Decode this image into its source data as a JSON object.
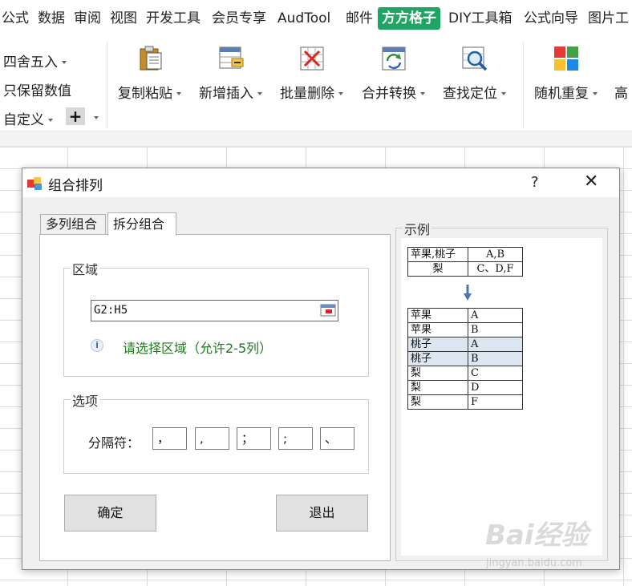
{
  "menubar": {
    "tabs": [
      "公式",
      "数据",
      "审阅",
      "视图",
      "开发工具",
      "会员专享",
      "AudTool",
      "邮件",
      "方方格子",
      "DIY工具箱",
      "公式向导",
      "图片工"
    ],
    "active": "方方格子"
  },
  "ribbon": {
    "small": {
      "round": "四舍五入",
      "keep_values": "只保留数值",
      "custom": "自定义"
    },
    "plus": "+",
    "buttons": [
      "复制粘贴",
      "新增插入",
      "批量删除",
      "合并转换",
      "查找定位",
      "随机重复",
      "高"
    ]
  },
  "dialog": {
    "title": "组合排列",
    "help": "?",
    "close": "✕",
    "tabs": [
      "多列组合",
      "拆分组合"
    ],
    "active_tab": "拆分组合",
    "range_group": "区域",
    "range_value": "G2:H5",
    "info_icon": "i",
    "hint": "请选择区域（允许2-5列）",
    "options_group": "选项",
    "separator_label": "分隔符：",
    "separators": [
      "，",
      ",",
      "；",
      ";",
      "、"
    ],
    "ok": "确定",
    "exit": "退出",
    "example_group": "示例",
    "example_source": [
      [
        "苹果,桃子",
        "A,B"
      ],
      [
        "梨",
        "C、D,F"
      ]
    ],
    "example_result": [
      [
        "苹果",
        "A"
      ],
      [
        "苹果",
        "B"
      ],
      [
        "桃子",
        "A"
      ],
      [
        "桃子",
        "B"
      ],
      [
        "梨",
        "C"
      ],
      [
        "梨",
        "D"
      ],
      [
        "梨",
        "F"
      ]
    ],
    "highlight_rows": [
      2,
      3
    ]
  },
  "watermark": {
    "main": "Bai经验",
    "sub": "jingyan.baidu.com"
  },
  "colors": {
    "accent": "#1fa463",
    "hint": "#1f7a1f",
    "highlight": "#dce6f1"
  }
}
